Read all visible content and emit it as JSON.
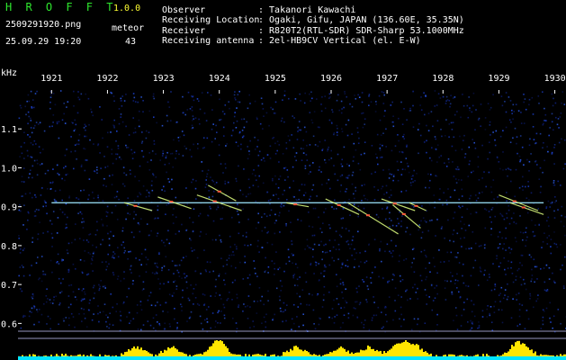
{
  "header": {
    "brand": "H R O F F T",
    "version": "1.0.0",
    "filename": "2509291920.png",
    "datetime": "25.09.29 19:20",
    "meteor_label": "meteor",
    "meteor_count": "43",
    "info": [
      {
        "key": "Observer",
        "value": ": Takanori Kawachi"
      },
      {
        "key": "Receiving Location",
        "value": ": Ogaki, Gifu, JAPAN (136.60E, 35.35N)"
      },
      {
        "key": "Receiver",
        "value": ": R820T2(RTL-SDR) SDR-Sharp 53.1000MHz"
      },
      {
        "key": "Receiving antenna",
        "value": ": 2el-HB9CV Vertical (el. E-W)"
      }
    ]
  },
  "colors": {
    "background": "#000000",
    "noise": "#0c1a66",
    "carrier": "#9fe8ff",
    "trace": "#e0ff80",
    "power": "#ffe600",
    "baseline": "#00e5ff",
    "brand": "#2ee62e",
    "version": "#ffff33"
  },
  "chart_data": {
    "type": "heatmap",
    "ylabel": "kHz",
    "y_ticks": [
      {
        "value": 1.1,
        "label": "1.1"
      },
      {
        "value": 1.0,
        "label": "1.0"
      },
      {
        "value": 0.9,
        "label": "0.9"
      },
      {
        "value": 0.8,
        "label": "0.8"
      },
      {
        "value": 0.7,
        "label": "0.7"
      },
      {
        "value": 0.6,
        "label": "0.6"
      }
    ],
    "ylim": [
      0.58,
      1.2
    ],
    "x_ticks": [
      "1921",
      "1922",
      "1923",
      "1924",
      "1925",
      "1926",
      "1927",
      "1928",
      "1929",
      "1930"
    ],
    "xlim": [
      1920.4,
      1930.2
    ],
    "carrier_khz": 0.91,
    "meteor_traces": [
      {
        "t": 1922.3,
        "f": 0.91,
        "dt": 0.5,
        "df": -0.02
      },
      {
        "t": 1922.9,
        "f": 0.925,
        "dt": 0.6,
        "df": -0.03
      },
      {
        "t": 1923.6,
        "f": 0.93,
        "dt": 0.8,
        "df": -0.04
      },
      {
        "t": 1923.8,
        "f": 0.955,
        "dt": 0.5,
        "df": -0.04
      },
      {
        "t": 1925.2,
        "f": 0.91,
        "dt": 0.4,
        "df": -0.01
      },
      {
        "t": 1925.9,
        "f": 0.92,
        "dt": 0.6,
        "df": -0.04
      },
      {
        "t": 1926.3,
        "f": 0.91,
        "dt": 0.9,
        "df": -0.08
      },
      {
        "t": 1926.9,
        "f": 0.92,
        "dt": 0.6,
        "df": -0.03
      },
      {
        "t": 1927.1,
        "f": 0.905,
        "dt": 0.5,
        "df": -0.06
      },
      {
        "t": 1927.4,
        "f": 0.91,
        "dt": 0.3,
        "df": -0.02
      },
      {
        "t": 1929.0,
        "f": 0.93,
        "dt": 0.7,
        "df": -0.04
      },
      {
        "t": 1929.2,
        "f": 0.91,
        "dt": 0.6,
        "df": -0.03
      }
    ]
  }
}
